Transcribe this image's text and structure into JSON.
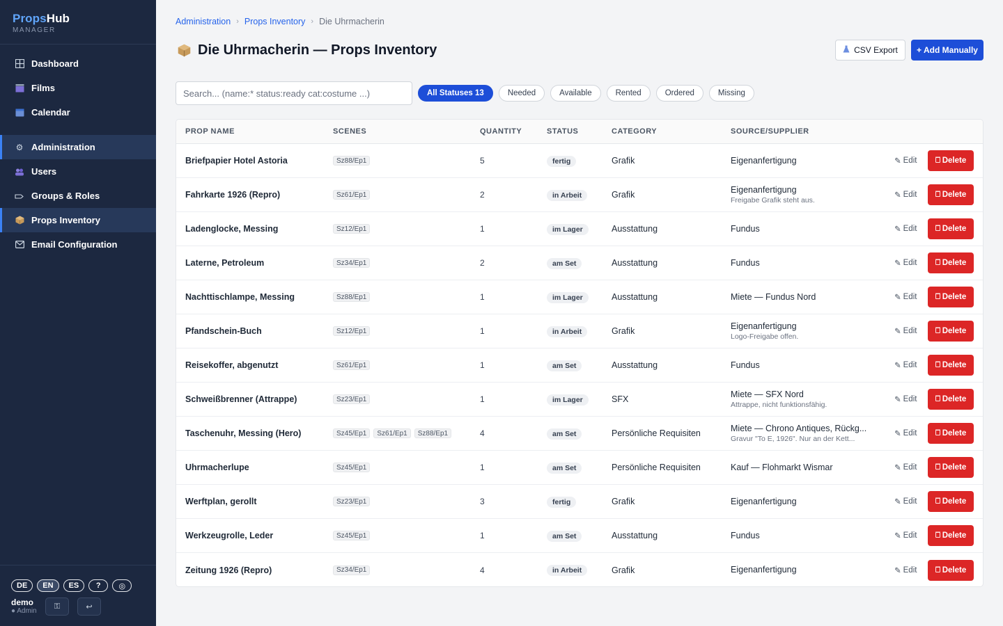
{
  "brand": {
    "name_part1": "Props",
    "name_part2": "Hub",
    "subtitle": "MANAGER"
  },
  "nav": {
    "group1": [
      {
        "label": "Dashboard",
        "icon": "grid-icon"
      },
      {
        "label": "Films",
        "icon": "clapperboard-icon"
      },
      {
        "label": "Calendar",
        "icon": "calendar-icon"
      }
    ],
    "group2": [
      {
        "label": "Administration",
        "icon": "gear-icon"
      },
      {
        "label": "Users",
        "icon": "users-icon"
      },
      {
        "label": "Groups & Roles",
        "icon": "tag-icon"
      },
      {
        "label": "Props Inventory",
        "icon": "package-icon"
      },
      {
        "label": "Email Configuration",
        "icon": "mail-icon"
      }
    ],
    "active": "Props Inventory"
  },
  "languages": [
    "DE",
    "EN",
    "ES",
    "?",
    "◎"
  ],
  "active_language": "EN",
  "user": {
    "name": "demo",
    "role": "● Admin"
  },
  "breadcrumb": {
    "item1": "Administration",
    "item2": "Props Inventory",
    "current": "Die Uhrmacherin"
  },
  "page": {
    "title": "Die Uhrmacherin — Props Inventory"
  },
  "toolbar": {
    "csv_label": "CSV Export",
    "add_label": "+ Add Manually"
  },
  "search": {
    "placeholder": "Search... (name:* status:ready cat:costume ...)"
  },
  "filters": [
    {
      "label": "All Statuses 13",
      "active": true
    },
    {
      "label": "Needed",
      "active": false
    },
    {
      "label": "Available",
      "active": false
    },
    {
      "label": "Rented",
      "active": false
    },
    {
      "label": "Ordered",
      "active": false
    },
    {
      "label": "Missing",
      "active": false
    }
  ],
  "table": {
    "columns": [
      "PROP NAME",
      "SCENES",
      "QUANTITY",
      "STATUS",
      "CATEGORY",
      "SOURCE/SUPPLIER"
    ],
    "edit_label": "Edit",
    "delete_label": "Delete",
    "rows": [
      {
        "name": "Briefpapier Hotel Astoria",
        "scenes": [
          "Sz88/Ep1"
        ],
        "qty": "5",
        "status": "fertig",
        "category": "Grafik",
        "source": "Eigenanfertigung",
        "note": ""
      },
      {
        "name": "Fahrkarte 1926 (Repro)",
        "scenes": [
          "Sz61/Ep1"
        ],
        "qty": "2",
        "status": "in Arbeit",
        "category": "Grafik",
        "source": "Eigenanfertigung",
        "note": "Freigabe Grafik steht aus."
      },
      {
        "name": "Ladenglocke, Messing",
        "scenes": [
          "Sz12/Ep1"
        ],
        "qty": "1",
        "status": "im Lager",
        "category": "Ausstattung",
        "source": "Fundus",
        "note": ""
      },
      {
        "name": "Laterne, Petroleum",
        "scenes": [
          "Sz34/Ep1"
        ],
        "qty": "2",
        "status": "am Set",
        "category": "Ausstattung",
        "source": "Fundus",
        "note": ""
      },
      {
        "name": "Nachttischlampe, Messing",
        "scenes": [
          "Sz88/Ep1"
        ],
        "qty": "1",
        "status": "im Lager",
        "category": "Ausstattung",
        "source": "Miete — Fundus Nord",
        "note": ""
      },
      {
        "name": "Pfandschein-Buch",
        "scenes": [
          "Sz12/Ep1"
        ],
        "qty": "1",
        "status": "in Arbeit",
        "category": "Grafik",
        "source": "Eigenanfertigung",
        "note": "Logo-Freigabe offen."
      },
      {
        "name": "Reisekoffer, abgenutzt",
        "scenes": [
          "Sz61/Ep1"
        ],
        "qty": "1",
        "status": "am Set",
        "category": "Ausstattung",
        "source": "Fundus",
        "note": ""
      },
      {
        "name": "Schweißbrenner (Attrappe)",
        "scenes": [
          "Sz23/Ep1"
        ],
        "qty": "1",
        "status": "im Lager",
        "category": "SFX",
        "source": "Miete — SFX Nord",
        "note": "Attrappe, nicht funktionsfähig."
      },
      {
        "name": "Taschenuhr, Messing (Hero)",
        "scenes": [
          "Sz45/Ep1",
          "Sz61/Ep1",
          "Sz88/Ep1"
        ],
        "qty": "4",
        "status": "am Set",
        "category": "Persönliche Requisiten",
        "source": "Miete — Chrono Antiques, Rückg...",
        "note": "Gravur \"To E, 1926\". Nur an der Kett..."
      },
      {
        "name": "Uhrmacherlupe",
        "scenes": [
          "Sz45/Ep1"
        ],
        "qty": "1",
        "status": "am Set",
        "category": "Persönliche Requisiten",
        "source": "Kauf — Flohmarkt Wismar",
        "note": ""
      },
      {
        "name": "Werftplan, gerollt",
        "scenes": [
          "Sz23/Ep1"
        ],
        "qty": "3",
        "status": "fertig",
        "category": "Grafik",
        "source": "Eigenanfertigung",
        "note": ""
      },
      {
        "name": "Werkzeugrolle, Leder",
        "scenes": [
          "Sz45/Ep1"
        ],
        "qty": "1",
        "status": "am Set",
        "category": "Ausstattung",
        "source": "Fundus",
        "note": ""
      },
      {
        "name": "Zeitung 1926 (Repro)",
        "scenes": [
          "Sz34/Ep1"
        ],
        "qty": "4",
        "status": "in Arbeit",
        "category": "Grafik",
        "source": "Eigenanfertigung",
        "note": ""
      }
    ]
  },
  "colors": {
    "sidebar_bg": "#1c2840",
    "accent": "#1d4ed8",
    "danger": "#dc2626"
  }
}
